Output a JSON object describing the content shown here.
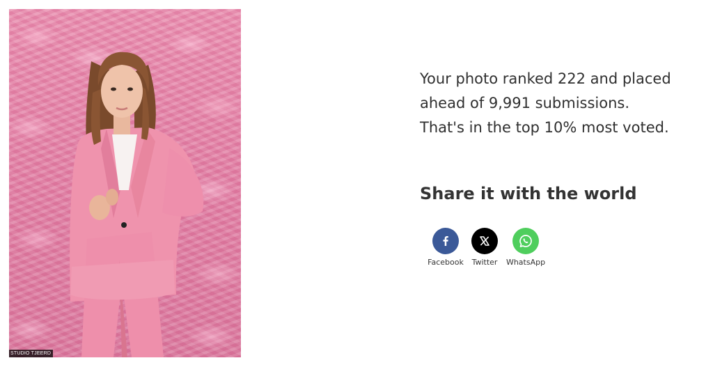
{
  "photo": {
    "alt": "Girl in pink suit against pink feather backdrop",
    "credit": "STUDIO TJEERD"
  },
  "result": {
    "line1": "Your photo ranked 222 and placed",
    "line2": "ahead of 9,991 submissions.",
    "line3": "That's in the top 10% most voted."
  },
  "share": {
    "title": "Share it with the world",
    "buttons": [
      {
        "label": "Facebook",
        "icon": "facebook-icon",
        "color": "#3b5998"
      },
      {
        "label": "Twitter",
        "icon": "x-icon",
        "color": "#000000"
      },
      {
        "label": "WhatsApp",
        "icon": "whatsapp-icon",
        "color": "#4fce5d"
      }
    ]
  }
}
